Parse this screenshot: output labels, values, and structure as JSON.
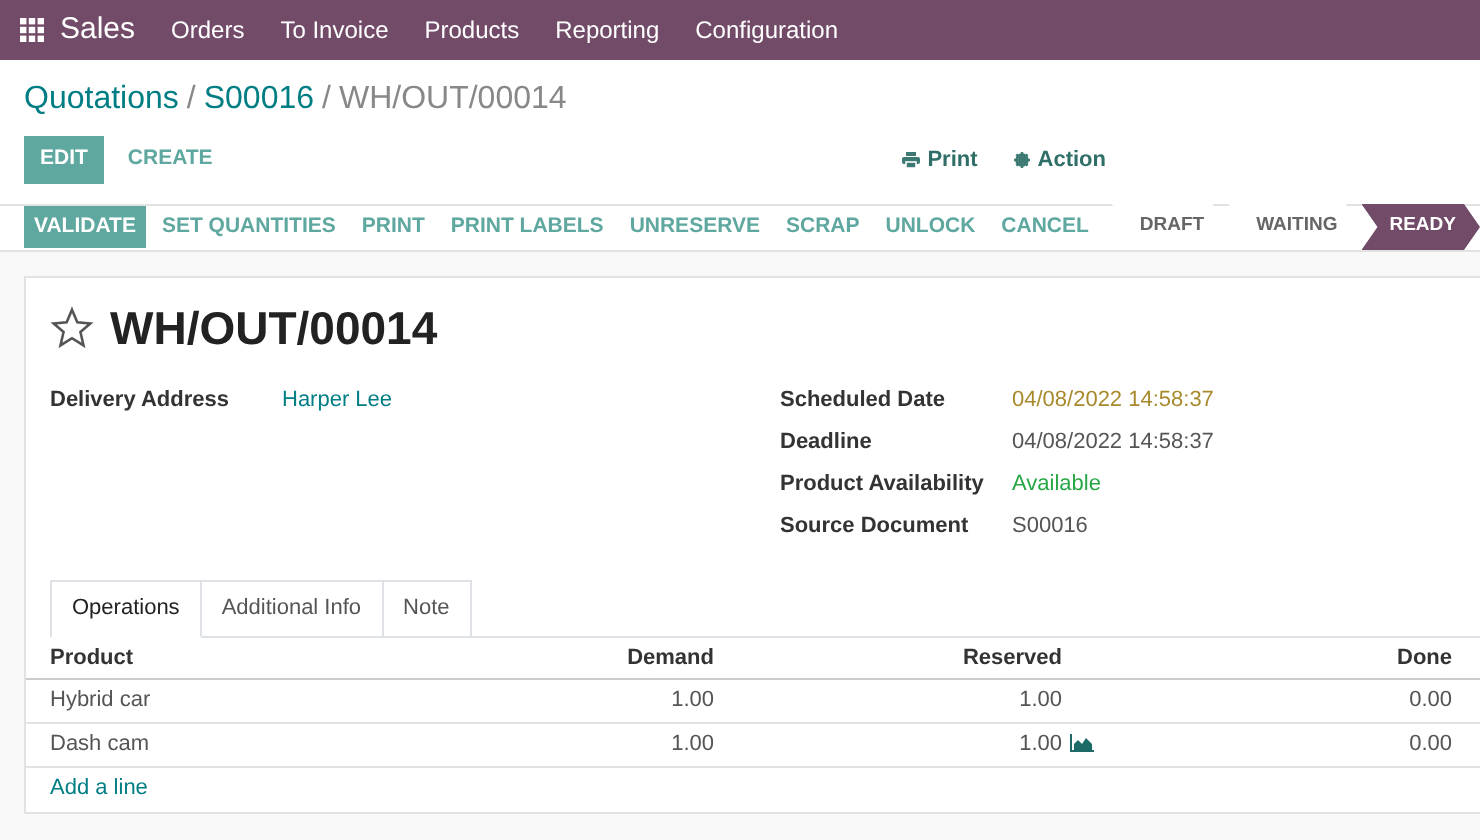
{
  "navbar": {
    "app": "Sales",
    "menu": [
      "Orders",
      "To Invoice",
      "Products",
      "Reporting",
      "Configuration"
    ]
  },
  "breadcrumb": [
    {
      "label": "Quotations",
      "link": true
    },
    {
      "separator": "/",
      "label": "S00016",
      "link": true
    },
    {
      "separator": "/",
      "label": "WH/OUT/00014",
      "link": false
    }
  ],
  "control_buttons": [
    {
      "label": "EDIT",
      "kind": "primary"
    },
    {
      "label": "CREATE",
      "kind": "secondary"
    }
  ],
  "sidebar_actions": [
    {
      "label": "Print",
      "kind": "print"
    },
    {
      "label": "Action",
      "kind": "gear"
    }
  ],
  "action_buttons": [
    {
      "label": "VALIDATE",
      "kind": "primary"
    },
    {
      "label": "SET QUANTITIES",
      "kind": "secondary"
    },
    {
      "label": "PRINT",
      "kind": "secondary"
    },
    {
      "label": "PRINT LABELS",
      "kind": "secondary"
    },
    {
      "label": "UNRESERVE",
      "kind": "secondary"
    },
    {
      "label": "SCRAP",
      "kind": "secondary"
    },
    {
      "label": "UNLOCK",
      "kind": "secondary"
    },
    {
      "label": "CANCEL",
      "kind": "secondary"
    }
  ],
  "stages": [
    {
      "label": "DRAFT",
      "selected": false
    },
    {
      "label": "WAITING",
      "selected": false
    },
    {
      "label": "READY",
      "selected": true
    }
  ],
  "record": {
    "title": "WH/OUT/00014",
    "starred": false
  },
  "left_fields": [
    {
      "label": "Delivery Address",
      "value": "Harper Lee",
      "kind": "link"
    }
  ],
  "right_fields": [
    {
      "label": "Scheduled Date",
      "value": "04/08/2022 14:58:37",
      "kind": "warning"
    },
    {
      "label": "Deadline",
      "value": "04/08/2022 14:58:37",
      "kind": "text"
    },
    {
      "label": "Product Availability",
      "value": "Available",
      "kind": "success"
    },
    {
      "label": "Source Document",
      "value": "S00016",
      "kind": "text"
    }
  ],
  "tabs": [
    {
      "label": "Operations",
      "selected": true
    },
    {
      "label": "Additional Info",
      "selected": false
    },
    {
      "label": "Note",
      "selected": false
    }
  ],
  "table": {
    "columns": [
      "Product",
      "Demand",
      "Reserved",
      "Done"
    ],
    "rows": [
      {
        "product": "Hybrid car",
        "demand": "1.00",
        "reserved": "1.00",
        "done": "0.00",
        "forecast_icon": false
      },
      {
        "product": "Dash cam",
        "demand": "1.00",
        "reserved": "1.00",
        "done": "0.00",
        "forecast_icon": true
      }
    ],
    "add_line": "Add a line"
  }
}
